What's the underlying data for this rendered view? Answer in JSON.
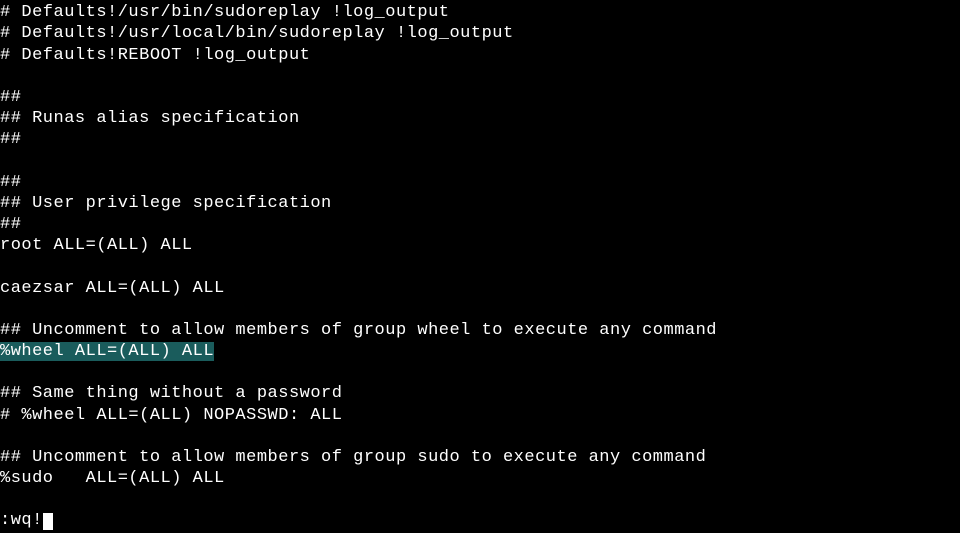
{
  "lines": {
    "l0": "# Defaults!/usr/bin/sudoreplay !log_output",
    "l1": "# Defaults!/usr/local/bin/sudoreplay !log_output",
    "l2": "# Defaults!REBOOT !log_output",
    "l3": "",
    "l4": "##",
    "l5": "## Runas alias specification",
    "l6": "##",
    "l7": "",
    "l8": "##",
    "l9": "## User privilege specification",
    "l10": "##",
    "l11": "root ALL=(ALL) ALL",
    "l12": "",
    "l13": "caezsar ALL=(ALL) ALL",
    "l14": "",
    "l15": "## Uncomment to allow members of group wheel to execute any command",
    "l16": "%wheel ALL=(ALL) ALL",
    "l17": "",
    "l18": "## Same thing without a password",
    "l19": "# %wheel ALL=(ALL) NOPASSWD: ALL",
    "l20": "",
    "l21": "## Uncomment to allow members of group sudo to execute any command",
    "l22": "%sudo   ALL=(ALL) ALL",
    "l23": ""
  },
  "command": ":wq!"
}
